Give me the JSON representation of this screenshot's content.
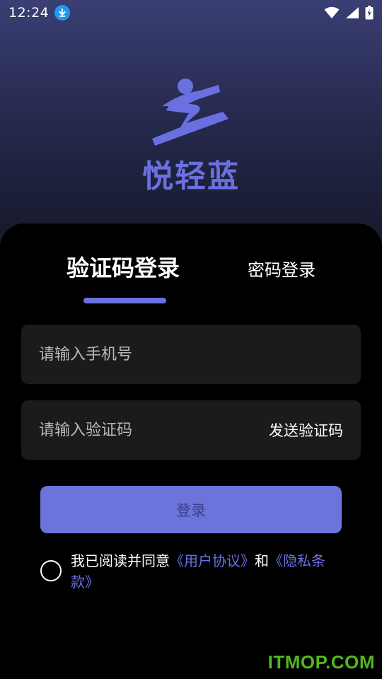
{
  "status_bar": {
    "time": "12:24",
    "icons": [
      "download-icon",
      "wifi-icon",
      "signal-icon",
      "battery-icon"
    ]
  },
  "brand": {
    "name": "悦轻蓝",
    "color": "#6b70e0"
  },
  "tabs": [
    {
      "label": "验证码登录",
      "active": true
    },
    {
      "label": "密码登录",
      "active": false
    }
  ],
  "form": {
    "phone_placeholder": "请输入手机号",
    "code_placeholder": "请输入验证码",
    "send_code_label": "发送验证码",
    "login_label": "登录"
  },
  "agreement": {
    "prefix": "我已阅读并同意",
    "user_agreement": "《用户协议》",
    "and": "和",
    "privacy_policy": "《隐私条款》",
    "checked": false
  },
  "watermark": "ITMOP.COM",
  "colors": {
    "accent": "#6b70e0",
    "button": "#6b74da",
    "field_bg": "#1b1b1b",
    "watermark": "#4fb81e"
  }
}
